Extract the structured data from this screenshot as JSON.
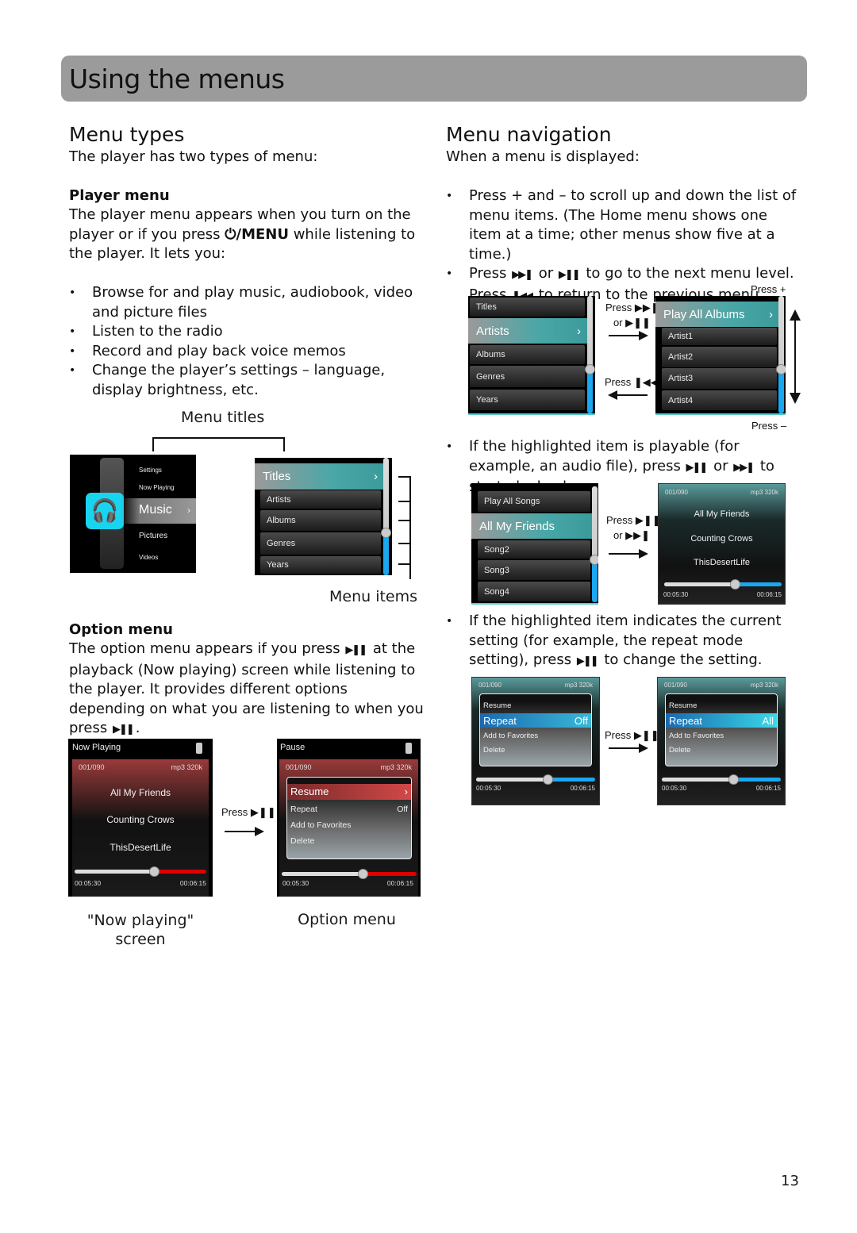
{
  "page": {
    "title": "Using the menus",
    "page_number": "13"
  },
  "menu_types": {
    "heading": "Menu types",
    "intro": "The player has two types of menu:",
    "player_menu": {
      "heading": "Player menu",
      "text_before": "The player menu appears when you turn on the player or if you press ",
      "key": "⏻/MENU",
      "text_after": " while listening to the player. It lets you:",
      "bullets": [
        "Browse for and play music, audiobook, video and picture files",
        "Listen to the radio",
        "Record and play back voice memos",
        "Change the player’s settings – language, display brightness, etc."
      ]
    },
    "diagram": {
      "menu_titles_label": "Menu titles",
      "menu_items_label": "Menu items",
      "home_items": [
        "Settings",
        "Now Playing",
        "Music",
        "Pictures",
        "Videos"
      ],
      "home_selected": "Music",
      "list_selected": "Titles",
      "list_items": [
        "Artists",
        "Albums",
        "Genres",
        "Years"
      ]
    },
    "option_menu": {
      "heading": "Option menu",
      "text_1": "The option menu appears if you press ",
      "key": "▶❚❚",
      "text_2": " at the playback (Now playing) screen while listening to the player. It provides different options depending on what you are listening to when you press ",
      "text_3": "."
    },
    "now_playing_screen": {
      "header": "Now Playing",
      "track": "001/090",
      "format": "mp3 320k",
      "song": "All My Friends",
      "artist": "Counting Crows",
      "album": "ThisDesertLife",
      "elapsed": "00:05:30",
      "total": "00:06:15",
      "progress": 0.6,
      "caption_1": "\"Now playing\"",
      "caption_2": "screen"
    },
    "transition_label": "Press ▶❚❚",
    "option_screen": {
      "header": "Pause",
      "track": "001/090",
      "format": "mp3 320k",
      "items": [
        {
          "label": "Resume",
          "value": "›"
        },
        {
          "label": "Repeat",
          "value": "Off"
        },
        {
          "label": "Add to Favorites",
          "value": ""
        },
        {
          "label": "Delete",
          "value": ""
        }
      ],
      "elapsed": "00:05:30",
      "total": "00:06:15",
      "progress": 0.6,
      "caption": "Option menu"
    }
  },
  "menu_navigation": {
    "heading": "Menu navigation",
    "intro": "When a menu is displayed:",
    "bullet_1": "Press + and – to scroll up and down the list of menu items. (The Home menu shows one item at a time; other menus show five at a time.)",
    "bullet_2_a": "Press ",
    "bullet_2_b": " or ",
    "bullet_2_c": " to go to the next menu level. Press ",
    "bullet_2_d": " to return to the previous menu level.",
    "bullet_3_a": "If the highlighted item is playable (for example, an audio file), press ",
    "bullet_3_b": " or ",
    "bullet_3_c": " to start playback.",
    "bullet_4_a": "If the highlighted item indicates the current setting (for example, the repeat mode setting), press ",
    "bullet_4_b": " to change the setting.",
    "icons": {
      "next": "▶▶❚",
      "play_pause": "▶❚❚",
      "prev": "❚◀◀"
    },
    "diagram_1": {
      "left_items": [
        "Titles",
        "Artists",
        "Albums",
        "Genres",
        "Years"
      ],
      "left_selected": "Artists",
      "right_selected": "Play All Albums",
      "right_items": [
        "Artist1",
        "Artist2",
        "Artist3",
        "Artist4"
      ],
      "press_forward_1": "Press ▶▶❚",
      "press_forward_2": "or ▶❚❚",
      "press_back": "Press ❚◀◀",
      "press_plus": "Press +",
      "press_minus": "Press –"
    },
    "diagram_2": {
      "items_top": "Play All Songs",
      "selected": "All My Friends",
      "items": [
        "Song2",
        "Song3",
        "Song4"
      ],
      "press_1": "Press ▶❚❚",
      "press_2": "or ▶▶❚",
      "track": "001/090",
      "format": "mp3 320k",
      "song": "All My Friends",
      "artist": "Counting Crows",
      "album": "ThisDesertLife",
      "elapsed": "00:05:30",
      "total": "00:06:15",
      "progress": 0.6
    },
    "diagram_3": {
      "track": "001/090",
      "format": "mp3 320k",
      "items": [
        "Resume",
        "Repeat",
        "Add to Favorites",
        "Delete"
      ],
      "before_value": "Off",
      "after_value": "All",
      "press": "Press ▶❚❚",
      "elapsed": "00:05:30",
      "total": "00:06:15",
      "progress": 0.6
    }
  }
}
